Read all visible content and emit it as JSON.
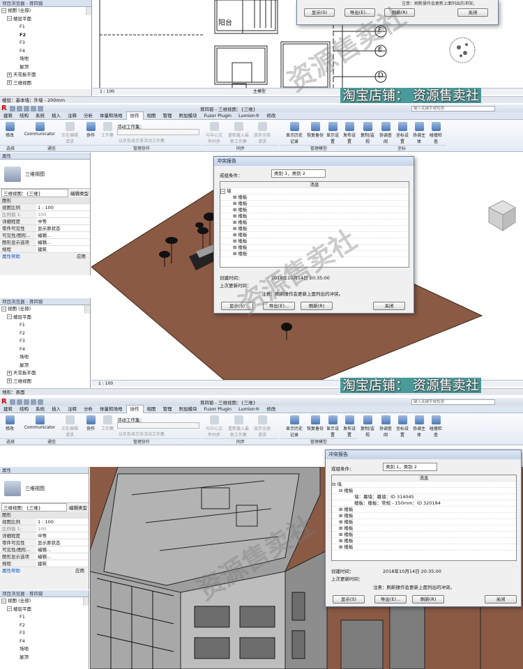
{
  "shop_label": "淘宝店铺：",
  "shop_name": "资源售卖社",
  "watermark": "资源售卖社",
  "top": {
    "browser_title": "项目浏览器 - 茸四窗",
    "tree": [
      "视图 (全部)",
      "楼层平面",
      "F1",
      "F2",
      "F3",
      "F4",
      "场地",
      "屋顶",
      "天花板平面",
      "三维视图"
    ],
    "scale": "1 : 100",
    "status": "楼层：基本墙：外墙 - 200mm",
    "main_model": "主模型",
    "drawing_labels": [
      "阳台",
      "F",
      "E",
      "D"
    ],
    "dialog_note": "注意：刷新操作会更新上面列出的冲突。",
    "dialog_buttons": [
      "显示(S)",
      "导出(E)...",
      "刷新(R)",
      "关闭"
    ]
  },
  "app": {
    "title": "茸四窗 - 三维视图：{三维}",
    "search_placeholder": "键入关键字或短语",
    "tabs": [
      "建筑",
      "结构",
      "系统",
      "插入",
      "注释",
      "分析",
      "体量和场地",
      "协作",
      "视图",
      "管理",
      "附加模块",
      "Fuzor Plugin",
      "Lumion®",
      "修改"
    ],
    "active_tab": "协作",
    "ribbon_buttons": [
      "修改",
      "Communicator",
      "正在编辑请求",
      "协作",
      "工作集",
      "与中心文件同步",
      "重新载入最新工作集",
      "放弃全部请求",
      "显示历史记录",
      "恢复备份",
      "显示设置",
      "发布设置",
      "复制/监视",
      "协调查阅",
      "坐标设置",
      "协调主体",
      "碰撞检查"
    ],
    "ribbon_groups": [
      "选择",
      "通信",
      "管理协作",
      "同步",
      "管理模型",
      "坐标"
    ],
    "active_workset_label": "活动工作集：",
    "gray_workset_label": "以灰色显示非活动工作集",
    "properties_title": "属性",
    "view_type": "三维视图",
    "view_selector": "三维视图：{三维}",
    "edit_type": "编辑类型",
    "graphics_label": "图形",
    "props": [
      [
        "视图比例",
        "1 : 100"
      ],
      [
        "比例值 1:",
        "100"
      ],
      [
        "详细程度",
        "中等"
      ],
      [
        "零件可见性",
        "显示原状态"
      ],
      [
        "可见性/图形...",
        "编辑..."
      ],
      [
        "图形显示选项",
        "编辑..."
      ],
      [
        "规程",
        "建筑"
      ]
    ],
    "props_help": "属性帮助",
    "apply": "应用",
    "browser_title": "项目浏览器 - 茸四窗",
    "tree": [
      "视图 (全部)",
      "楼层平面",
      "F1",
      "F2",
      "F3",
      "F4",
      "场地",
      "屋顶",
      "天花板平面",
      "三维视图"
    ],
    "scale": "1 : 100",
    "status_left": "地形：表面",
    "main_model": "主模型"
  },
  "dialog1": {
    "title": "冲突报告",
    "group_label": "成组条件：",
    "group_value": "类别 1，类别 2",
    "col_header": "消息",
    "rows": [
      "墙",
      "楼板",
      "楼板",
      "楼板",
      "楼板",
      "楼板",
      "楼板",
      "楼板",
      "楼板",
      "楼板",
      "楼板"
    ],
    "created_label": "创建时间：",
    "created_value": "2018年10月14日 20:35:00",
    "updated_label": "上次更新时间：",
    "note": "注意：刷新操作会更新上面列出的冲突。",
    "buttons": [
      "显示(S)",
      "导出(E)...",
      "刷新(R)",
      "关闭"
    ]
  },
  "dialog2": {
    "title": "冲突报告",
    "group_label": "成组条件：",
    "group_value": "类别 1，类别 2",
    "col_header": "消息",
    "rows": [
      "墙",
      "楼板",
      "墙：幕墙：幕墙：ID 314045",
      "楼板：楼板：常规 - 150mm：ID 320184",
      "楼板",
      "楼板",
      "楼板",
      "楼板",
      "楼板",
      "楼板",
      "楼板"
    ],
    "created_label": "创建时间：",
    "created_value": "2018年10月14日 20:35:00",
    "updated_label": "上次更新时间：",
    "note": "注意：刷新操作会更新上面列出的冲突。",
    "buttons": [
      "显示(S)",
      "导出(E)...",
      "刷新(R)",
      "关闭"
    ]
  },
  "colors": {
    "ground": "#8b5a44",
    "ribbon": "#e4ebf4",
    "accent": "#4a9a99"
  }
}
